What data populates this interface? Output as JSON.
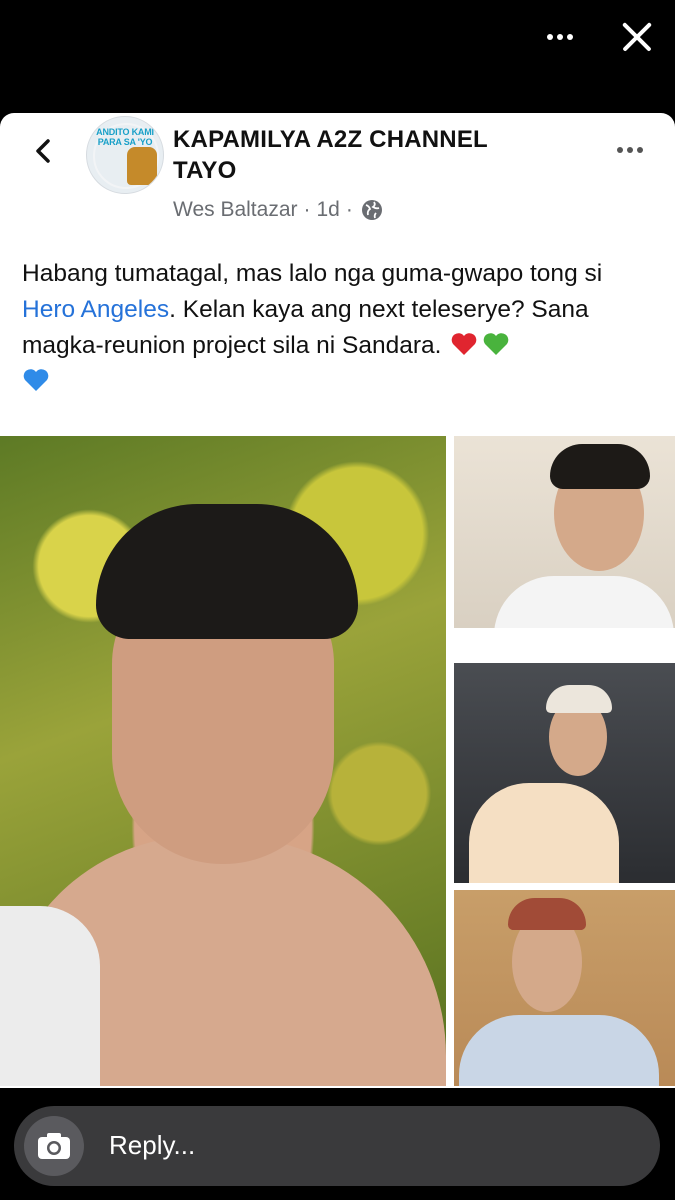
{
  "group": {
    "name_line1": "KAPAMILYA A2Z CHANNEL",
    "name_line2": "TAYO",
    "avatar_text": "ANDITO KAMI PARA SA 'YO"
  },
  "meta": {
    "author": "Wes Baltazar",
    "time": "1d",
    "separator": "·",
    "audience_icon": "globe-icon"
  },
  "post": {
    "text_1": "Habang tumatagal, mas lalo nga guma-gwapo tong si ",
    "mention": "Hero Angeles",
    "text_2": ". Kelan kaya ang next teleserye? Sana magka-reunion project sila ni Sandara.",
    "hearts": [
      "red-heart",
      "green-heart",
      "blue-heart"
    ]
  },
  "colors": {
    "mention": "#2572d9",
    "red_heart": "#e0252f",
    "green_heart": "#49b33d",
    "blue_heart": "#2f8be8"
  },
  "reply": {
    "placeholder": "Reply..."
  }
}
